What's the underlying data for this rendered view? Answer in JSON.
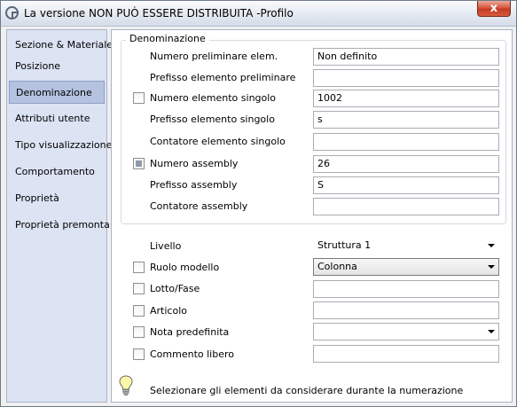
{
  "window": {
    "title": "La versione NON PUÒ ESSERE DISTRIBUITA -Profilo",
    "close_label": "x"
  },
  "sidebar": {
    "items": [
      {
        "label": "Sezione & Materiale"
      },
      {
        "label": "Posizione"
      },
      {
        "label": "Denominazione",
        "selected": true
      },
      {
        "label": "Attributi utente"
      },
      {
        "label": "Tipo visualizzazione"
      },
      {
        "label": "Comportamento"
      },
      {
        "label": "Proprietà"
      },
      {
        "label": "Proprietà premonta"
      }
    ]
  },
  "group": {
    "title": "Denominazione",
    "rows": [
      {
        "label": "Numero preliminare elem.",
        "value": "Non definito",
        "checkbox": "none"
      },
      {
        "label": "Prefisso elemento preliminare",
        "value": "",
        "checkbox": "none"
      },
      {
        "label": "Numero elemento singolo",
        "value": "1002",
        "checkbox": "unchecked"
      },
      {
        "label": "Prefisso elemento singolo",
        "value": "s",
        "checkbox": "none"
      },
      {
        "label": "Contatore elemento singolo",
        "value": "",
        "checkbox": "none"
      },
      {
        "label": "Numero assembly",
        "value": "26",
        "checkbox": "indeterminate"
      },
      {
        "label": "Prefisso assembly",
        "value": "S",
        "checkbox": "none"
      },
      {
        "label": "Contatore assembly",
        "value": "",
        "checkbox": "none"
      }
    ]
  },
  "lower": {
    "livello": {
      "label": "Livello",
      "value": "Struttura 1"
    },
    "ruolo_modello": {
      "label": "Ruolo modello",
      "value": "Colonna",
      "checked": false
    },
    "lotto_fase": {
      "label": "Lotto/Fase",
      "value": "",
      "checked": false
    },
    "articolo": {
      "label": "Articolo",
      "value": "",
      "checked": false
    },
    "nota_predefinita": {
      "label": "Nota predefinita",
      "value": "",
      "checked": false
    },
    "commento_libero": {
      "label": "Commento libero",
      "value": "",
      "checked": false
    }
  },
  "hint": {
    "text": "Selezionare gli elementi da considerare durante la numerazione",
    "icon": "lightbulb-icon"
  },
  "colors": {
    "sidebar_bg": "#dce3f3",
    "sidebar_selected": "#b5c3e0",
    "close_button": "#c43a22"
  }
}
